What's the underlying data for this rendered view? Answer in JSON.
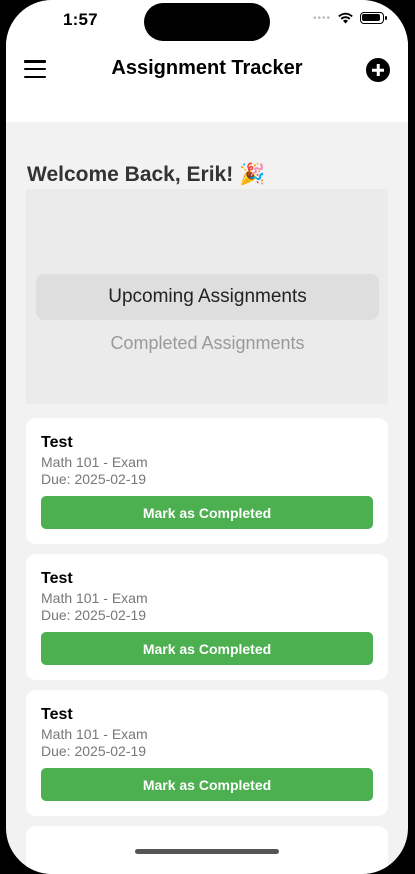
{
  "status_bar": {
    "time": "1:57",
    "signal": "••••"
  },
  "header": {
    "title": "Assignment Tracker",
    "menu_icon": "menu-icon",
    "add_icon": "plus-circle-icon"
  },
  "welcome": "Welcome Back, Erik! 🎉",
  "tabs": {
    "upcoming": "Upcoming Assignments",
    "completed": "Completed Assignments",
    "selected": "upcoming"
  },
  "assignments": [
    {
      "title": "Test",
      "course": "Math 101 - Exam",
      "due": "Due: 2025-02-19",
      "action": "Mark as Completed"
    },
    {
      "title": "Test",
      "course": "Math 101 - Exam",
      "due": "Due: 2025-02-19",
      "action": "Mark as Completed"
    },
    {
      "title": "Test",
      "course": "Math 101 - Exam",
      "due": "Due: 2025-02-19",
      "action": "Mark as Completed"
    }
  ],
  "colors": {
    "accent": "#4caf50",
    "background": "#f2f2f2"
  }
}
